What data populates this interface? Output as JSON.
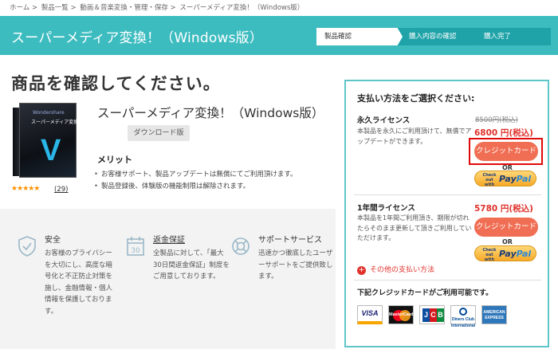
{
  "breadcrumb": [
    "ホーム",
    ">",
    "製品一覧",
    ">",
    "動画＆音楽変換・管理・保存",
    ">",
    "スーパーメディア変換！（Windows版）"
  ],
  "header": {
    "title": "スーパーメディア変換！（Windows版）",
    "steps": [
      "製品確認",
      "購入内容の確認",
      "購入完了"
    ]
  },
  "main": {
    "page_title": "商品を確認してください。",
    "product_name": "スーパーメディア変換！（Windows版）",
    "download_badge": "ダウンロード版",
    "box_label": "スーパーメディア変換！",
    "box_letter": "V",
    "box_brand": "Wondershare",
    "rating_stars": "★★★★★",
    "rating": 5,
    "review_count": "(29)",
    "merit_title": "メリット",
    "merits": [
      "お客様サポート、製品アップデートは無償にてご利用頂けます。",
      "製品登録後、体験版の機能制限は解除されます。"
    ]
  },
  "features": [
    {
      "icon": "shield-icon",
      "title": "安全",
      "body": "お客様のプライバシーを大切にし、高度な暗号化と不正防止対策を施し、金融情報・個人情報を保護しております。"
    },
    {
      "icon": "calendar-icon",
      "title": "返金保証",
      "icon_text": "30",
      "body": "全製品に対して、「最大30日間返金保証」制度をご用意しております。"
    },
    {
      "icon": "lifebuoy-icon",
      "title": "サポートサービス",
      "body": "迅速かつ徹底したユーザーサポートをご提供致します。"
    }
  ],
  "payment": {
    "title": "支払い方法をご選択ください:",
    "licenses": [
      {
        "name": "永久ライセンス",
        "desc": "本製品を永久にご利用頂けて、無償でアップデートができます。",
        "old_price": "8500円(税込)",
        "price": "6800 円(税込)",
        "card_button": "クレジットカード",
        "or": "OR"
      },
      {
        "name": "1年間ライセンス",
        "desc": "本製品を1年間ご利用頂き、期限が切れたらそのまま更新して頂きご利用していただけます。",
        "price": "5780 円(税込)",
        "card_button": "クレジットカード",
        "or": "OR"
      }
    ],
    "paypal": {
      "checkout": "Check out with",
      "pay": "Pay",
      "pal": "Pal"
    },
    "other_methods": "その他の支払い方法",
    "cards_title": "下記クレジッドカードがご利用可能です。",
    "cards": {
      "visa": "VISA",
      "mastercard": "MasterCard",
      "jcb": [
        "J",
        "C",
        "B"
      ],
      "diners": "Diners Club International",
      "amex": "AMERICAN EXPRESS"
    }
  },
  "colors": {
    "header_bg": "#3dbcc0",
    "step_active": "#1fa3a8",
    "cta": "#f06e53",
    "price": "#e0322c",
    "panel_border": "#5ec6c9",
    "highlight": "#e10a0a"
  }
}
